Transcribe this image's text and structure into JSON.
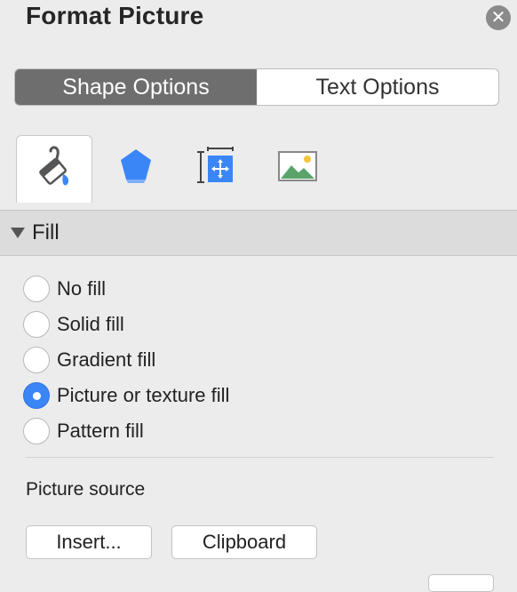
{
  "panel": {
    "title": "Format Picture",
    "close_icon": "close-icon"
  },
  "segmented": {
    "options": [
      "Shape Options",
      "Text Options"
    ],
    "selected": "Shape Options"
  },
  "icon_tabs": [
    {
      "name": "fill-line-icon",
      "active": true
    },
    {
      "name": "effects-pentagon-icon",
      "active": false
    },
    {
      "name": "size-properties-icon",
      "active": false
    },
    {
      "name": "picture-icon",
      "active": false
    }
  ],
  "fill_section": {
    "label": "Fill",
    "expanded": true,
    "options": [
      {
        "label": "No fill",
        "checked": false
      },
      {
        "label": "Solid fill",
        "checked": false
      },
      {
        "label": "Gradient fill",
        "checked": false
      },
      {
        "label": "Picture or texture fill",
        "checked": true
      },
      {
        "label": "Pattern fill",
        "checked": false
      }
    ],
    "picture_source_label": "Picture source",
    "buttons": {
      "insert": "Insert...",
      "clipboard": "Clipboard"
    }
  },
  "colors": {
    "accent": "#3b86f7",
    "segment_active": "#6e6e6e",
    "background": "#ececec"
  }
}
